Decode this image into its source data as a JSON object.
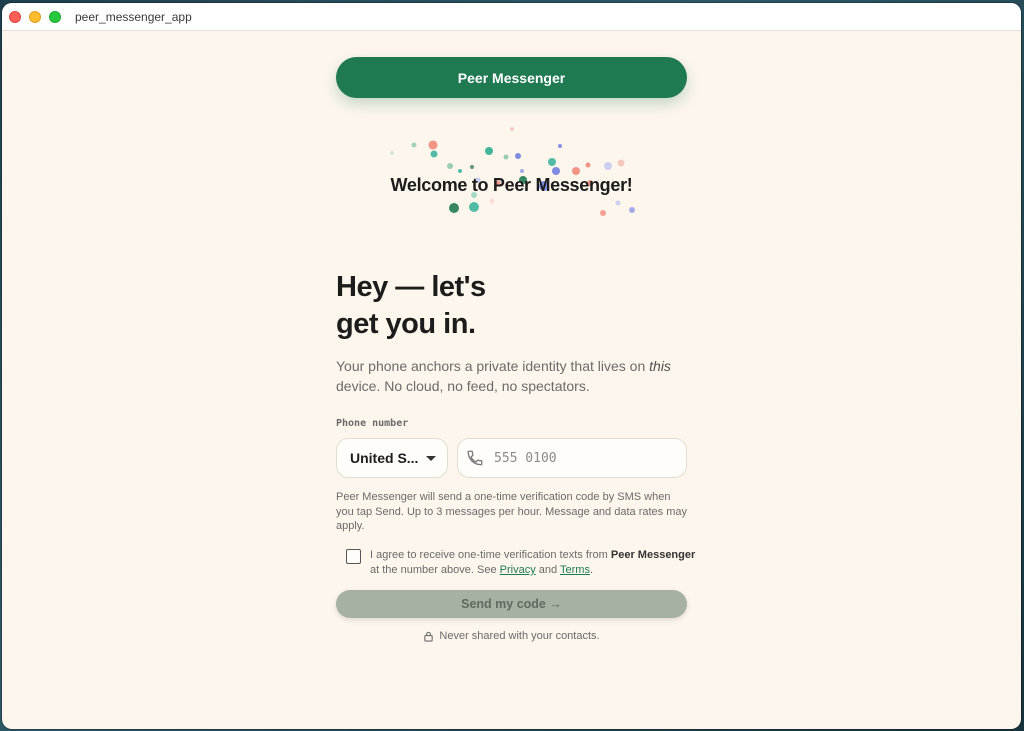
{
  "window": {
    "title": "peer_messenger_app"
  },
  "brand": {
    "label": "Peer Messenger",
    "color": "#1f7a52"
  },
  "welcome": "Welcome to Peer Messenger!",
  "headline": {
    "line1": "Hey — let's",
    "line2": "get you in."
  },
  "subtext": {
    "part1": "Your phone anchors a private identity that lives on ",
    "emph": "this",
    "part2": " device. No cloud, no feed, no spectators."
  },
  "phone": {
    "label": "Phone number",
    "country": "United S...",
    "placeholder": "555 0100",
    "icon": "phone-icon"
  },
  "disclosure": "Peer Messenger will send a one-time verification code by SMS when you tap Send. Up to 3 messages per hour. Message and data rates may apply.",
  "consent": {
    "part1": "I agree to receive one-time verification texts from ",
    "brand": "Peer Messenger",
    "part2": " at the number above. See ",
    "privacy": "Privacy",
    "and": " and ",
    "terms": "Terms",
    "end": ".",
    "checked": false
  },
  "send": {
    "label": "Send my code →",
    "enabled": false
  },
  "privacy_note": "Never shared with your contacts.",
  "colors": {
    "background": "#fdf6ec",
    "accent": "#1f7a52",
    "disabled_button": "#a6b0a3"
  }
}
